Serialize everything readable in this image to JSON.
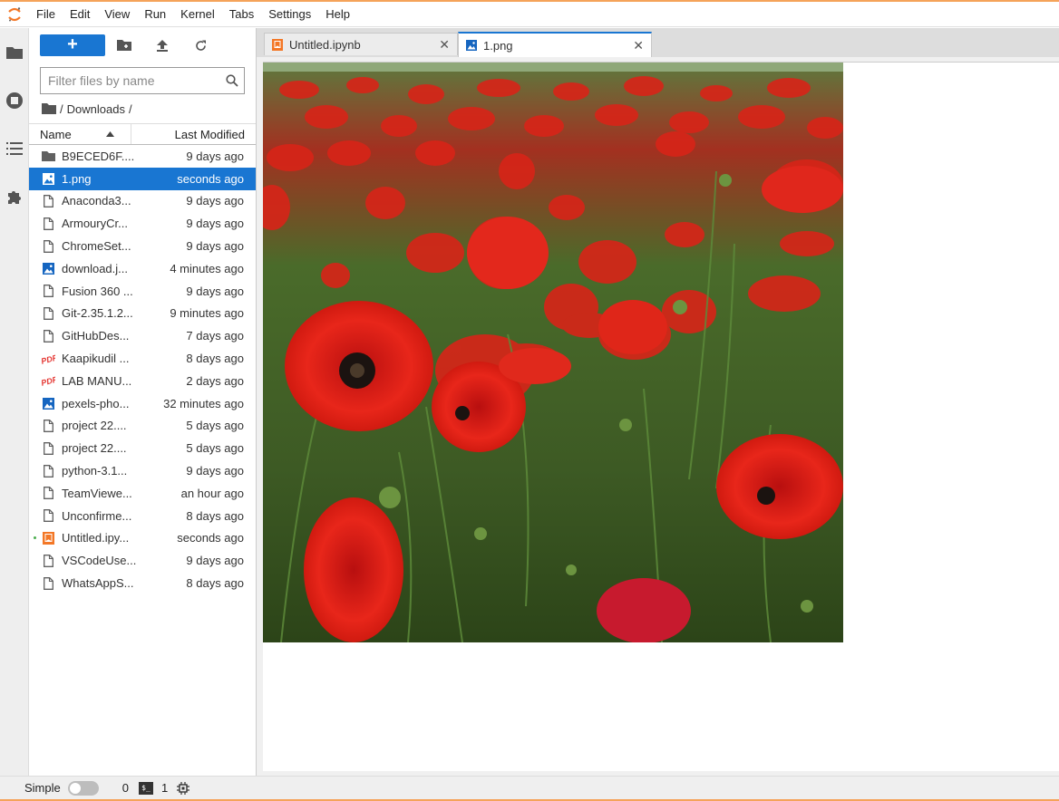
{
  "menu": [
    "File",
    "Edit",
    "View",
    "Run",
    "Kernel",
    "Tabs",
    "Settings",
    "Help"
  ],
  "filebrowser": {
    "new_label": "+",
    "filter_placeholder": "Filter files by name",
    "breadcrumb_sep": "/",
    "breadcrumb_folder": "Downloads",
    "col_name": "Name",
    "col_modified": "Last Modified",
    "files": [
      {
        "name": "B9ECED6F....",
        "modified": "9 days ago",
        "type": "folder"
      },
      {
        "name": "1.png",
        "modified": "seconds ago",
        "type": "image",
        "selected": true
      },
      {
        "name": "Anaconda3...",
        "modified": "9 days ago",
        "type": "file"
      },
      {
        "name": "ArmouryCr...",
        "modified": "9 days ago",
        "type": "file"
      },
      {
        "name": "ChromeSet...",
        "modified": "9 days ago",
        "type": "file"
      },
      {
        "name": "download.j...",
        "modified": "4 minutes ago",
        "type": "image"
      },
      {
        "name": "Fusion 360 ...",
        "modified": "9 days ago",
        "type": "file"
      },
      {
        "name": "Git-2.35.1.2...",
        "modified": "9 minutes ago",
        "type": "file"
      },
      {
        "name": "GitHubDes...",
        "modified": "7 days ago",
        "type": "file"
      },
      {
        "name": "Kaapikudil ...",
        "modified": "8 days ago",
        "type": "pdf"
      },
      {
        "name": "LAB MANU...",
        "modified": "2 days ago",
        "type": "pdf"
      },
      {
        "name": "pexels-pho...",
        "modified": "32 minutes ago",
        "type": "image"
      },
      {
        "name": "project 22....",
        "modified": "5 days ago",
        "type": "file"
      },
      {
        "name": "project 22....",
        "modified": "5 days ago",
        "type": "file"
      },
      {
        "name": "python-3.1...",
        "modified": "9 days ago",
        "type": "file"
      },
      {
        "name": "TeamViewe...",
        "modified": "an hour ago",
        "type": "file"
      },
      {
        "name": "Unconfirme...",
        "modified": "8 days ago",
        "type": "file"
      },
      {
        "name": "Untitled.ipy...",
        "modified": "seconds ago",
        "type": "notebook",
        "running": true
      },
      {
        "name": "VSCodeUse...",
        "modified": "9 days ago",
        "type": "file"
      },
      {
        "name": "WhatsAppS...",
        "modified": "8 days ago",
        "type": "file"
      }
    ]
  },
  "tabs": [
    {
      "label": "Untitled.ipynb",
      "icon": "notebook-icon",
      "active": false
    },
    {
      "label": "1.png",
      "icon": "image-icon",
      "active": true
    }
  ],
  "tab_close": "✕",
  "statusbar": {
    "mode_label": "Simple",
    "kernels_count": "0",
    "terminal_glyph": "$_",
    "terminals_count": "1"
  },
  "colors": {
    "accent": "#1976d2",
    "jupyter_orange": "#f37726",
    "pdf_red": "#e53935"
  }
}
